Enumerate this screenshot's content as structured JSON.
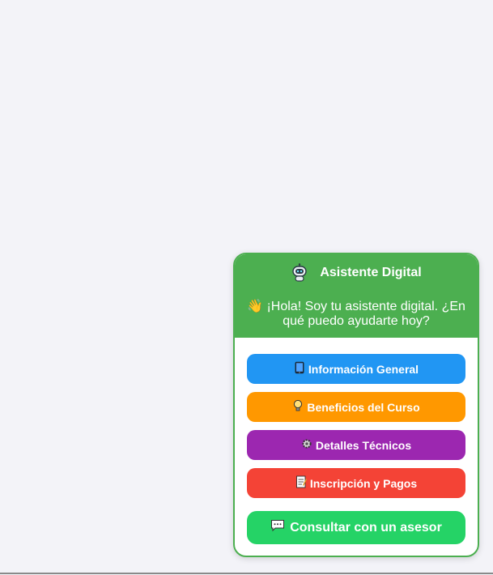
{
  "widget": {
    "title": "Asistente Digital",
    "bot_icon": "robot-icon",
    "greeting_icon": "waving-hand-icon",
    "greeting": "¡Hola! Soy tu asistente digital. ¿En qué puedo ayudarte hoy?",
    "colors": {
      "header": "#4caf50",
      "border": "#4caf50",
      "background": "#ffffff"
    },
    "options": [
      {
        "label": "Información General",
        "icon": "tablet-icon",
        "color": "#2196f3"
      },
      {
        "label": "Beneficios del Curso",
        "icon": "lightbulb-icon",
        "color": "#ff9800"
      },
      {
        "label": "Detalles Técnicos",
        "icon": "gear-icon",
        "color": "#9c27b0"
      },
      {
        "label": "Inscripción y Pagos",
        "icon": "memo-icon",
        "color": "#f44336"
      }
    ],
    "advisor": {
      "label": "Consultar con un asesor",
      "icon": "speech-bubble-icon",
      "color": "#25d366"
    }
  }
}
